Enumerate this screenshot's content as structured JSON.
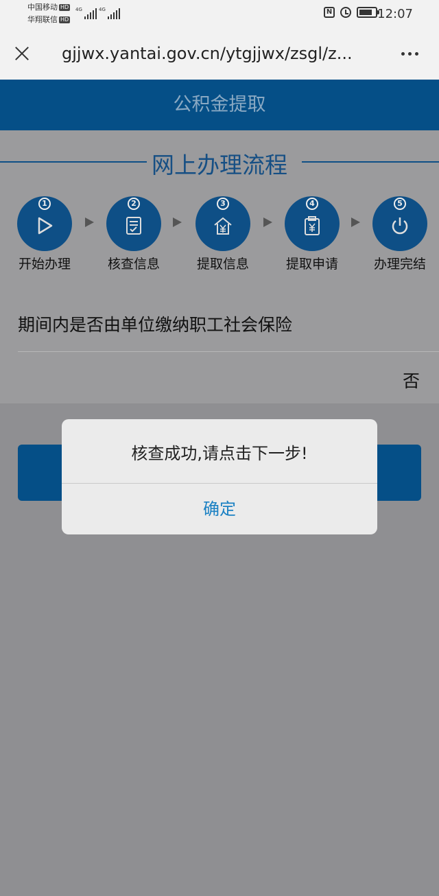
{
  "status_bar": {
    "carrier1": "中国移动",
    "carrier2": "华翔联信",
    "hd_badge": "HD",
    "network1": "4G",
    "network2": "4G",
    "nfc_icon": "N",
    "time": "12:07"
  },
  "browser": {
    "url": "gjjwx.yantai.gov.cn/ytgjjwx/zsgl/z...",
    "close_icon": "close-icon",
    "menu_icon": "more-vertical-icon"
  },
  "page": {
    "title": "公积金提取"
  },
  "process": {
    "title": "网上办理流程",
    "steps": [
      {
        "num": "1",
        "label": "开始办理",
        "icon": "play-icon"
      },
      {
        "num": "2",
        "label": "核查信息",
        "icon": "checklist-icon"
      },
      {
        "num": "3",
        "label": "提取信息",
        "icon": "house-yuan-icon"
      },
      {
        "num": "4",
        "label": "提取申请",
        "icon": "clipboard-yuan-icon"
      },
      {
        "num": "5",
        "label": "办理完结",
        "icon": "power-icon"
      }
    ]
  },
  "question": {
    "text": "期间内是否由单位缴纳职工社会保险",
    "answer": "否"
  },
  "dialog": {
    "message": "核查成功,请点击下一步!",
    "confirm_label": "确定"
  },
  "colors": {
    "brand": "#0e5ca7",
    "dialog_button": "#1a80c3"
  }
}
